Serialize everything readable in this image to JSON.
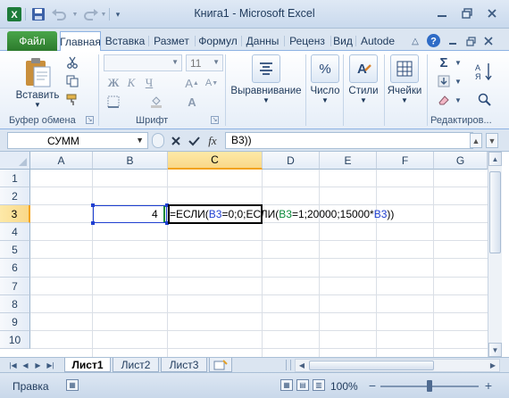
{
  "window": {
    "title": "Книга1 - Microsoft Excel",
    "app_icon": "excel-icon",
    "quick_access": [
      "save-icon",
      "undo-icon",
      "redo-icon",
      "customize-icon"
    ],
    "controls": [
      "minimize-icon",
      "restore-icon",
      "close-icon"
    ]
  },
  "ribbon": {
    "tabs": [
      {
        "label": "Файл",
        "kind": "file"
      },
      {
        "label": "Главная",
        "active": true
      },
      {
        "label": "Вставка"
      },
      {
        "label": "Размет"
      },
      {
        "label": "Формул"
      },
      {
        "label": "Данны"
      },
      {
        "label": "Реценз"
      },
      {
        "label": "Вид"
      },
      {
        "label": "Autode"
      }
    ],
    "groups": {
      "clipboard": {
        "label": "Буфер обмена",
        "paste_label": "Вставить"
      },
      "font": {
        "label": "Шрифт",
        "font_name": "",
        "font_size": "11"
      },
      "alignment": {
        "label": "Выравнивание"
      },
      "number": {
        "label": "Число"
      },
      "styles": {
        "label": "Стили"
      },
      "cells": {
        "label": "Ячейки"
      },
      "editing": {
        "label": "Редактиров..."
      }
    }
  },
  "formula_bar": {
    "name_box": "СУММ",
    "formula": "B3))"
  },
  "grid": {
    "columns": [
      "A",
      "B",
      "C",
      "D",
      "E",
      "F",
      "G"
    ],
    "selected_column": "C",
    "rows": [
      "1",
      "2",
      "3",
      "4",
      "5",
      "6",
      "7",
      "8",
      "9",
      "10"
    ],
    "selected_row": "3",
    "b3_value": "4",
    "editing_formula": [
      {
        "text": "=ЕСЛИ(",
        "tone": "plain"
      },
      {
        "text": "B3",
        "tone": "blue"
      },
      {
        "text": "=0;0;ЕСЛИ(",
        "tone": "plain"
      },
      {
        "text": "B3",
        "tone": "green"
      },
      {
        "text": "=1;20000;15000*",
        "tone": "plain"
      },
      {
        "text": "B3",
        "tone": "blue"
      },
      {
        "text": "))",
        "tone": "plain"
      }
    ]
  },
  "sheets": {
    "tabs": [
      "Лист1",
      "Лист2",
      "Лист3"
    ],
    "active": "Лист1"
  },
  "status": {
    "mode": "Правка",
    "zoom": "100%"
  },
  "colors": {
    "ref_blue": "#1f3fd1",
    "ref_green": "#0a8a3a",
    "file_tab": "#2c7a2c",
    "selection_header": "#f9d888"
  }
}
